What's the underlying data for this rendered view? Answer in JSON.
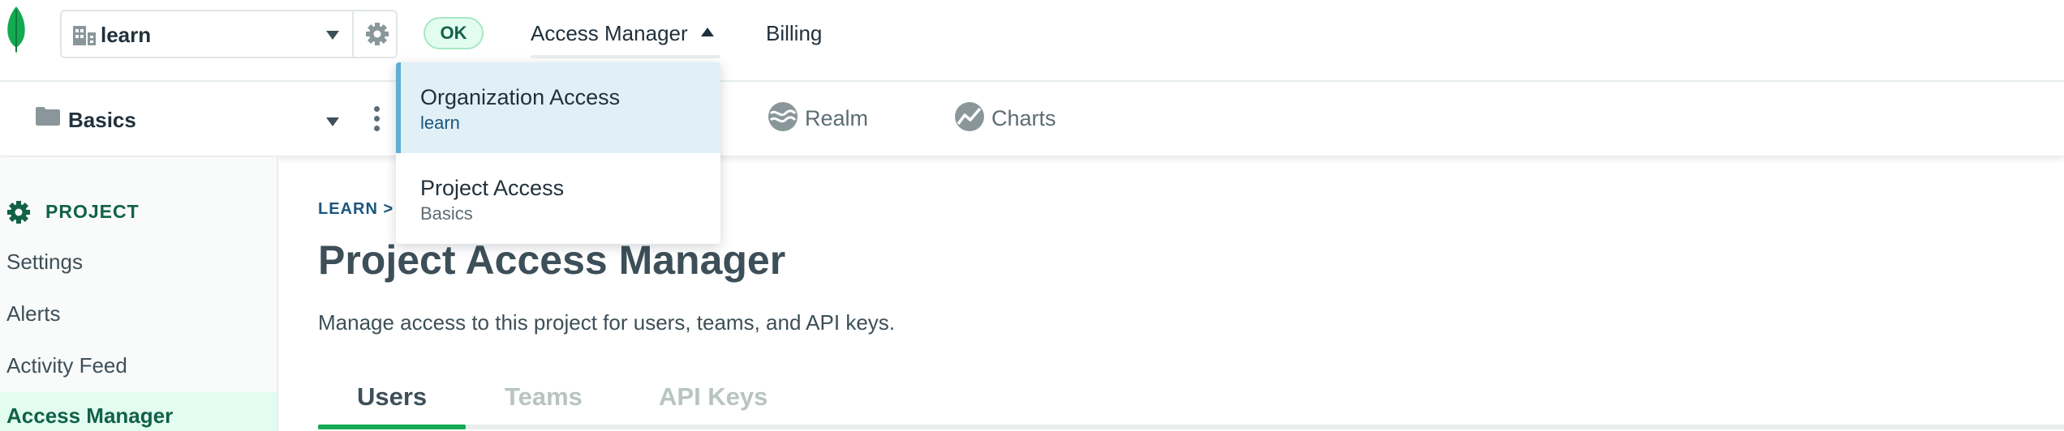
{
  "colors": {
    "brand_green": "#13aa52",
    "dark_green": "#116149",
    "link_blue": "#1a567e",
    "active_blue_bg": "#e1f0f6",
    "active_blue_bar": "#61aed4"
  },
  "topbar": {
    "logo_icon": "leaf-icon",
    "org_selector": {
      "icon": "building-icon",
      "value": "learn",
      "settings_icon": "gear-icon"
    },
    "status_badge": "OK",
    "nav": {
      "access_manager": "Access Manager",
      "billing": "Billing"
    }
  },
  "access_dropdown": {
    "items": [
      {
        "label": "Organization Access",
        "sub": "learn"
      },
      {
        "label": "Project Access",
        "sub": "Basics"
      }
    ]
  },
  "project_bar": {
    "icon": "folder-icon",
    "project_name": "Basics",
    "more_icon": "more-vertical-icon",
    "product_tabs": [
      {
        "label": "Realm",
        "icon": "realm-icon"
      },
      {
        "label": "Charts",
        "icon": "charts-icon"
      }
    ]
  },
  "sidebar": {
    "section_title": "PROJECT",
    "section_icon": "gear-icon",
    "items": [
      {
        "label": "Settings"
      },
      {
        "label": "Alerts"
      },
      {
        "label": "Activity Feed"
      },
      {
        "label": "Access Manager"
      }
    ]
  },
  "main": {
    "breadcrumb": "LEARN > B",
    "title": "Project Access Manager",
    "subtitle": "Manage access to this project for users, teams, and API keys.",
    "tabs": [
      {
        "label": "Users"
      },
      {
        "label": "Teams"
      },
      {
        "label": "API Keys"
      }
    ]
  }
}
